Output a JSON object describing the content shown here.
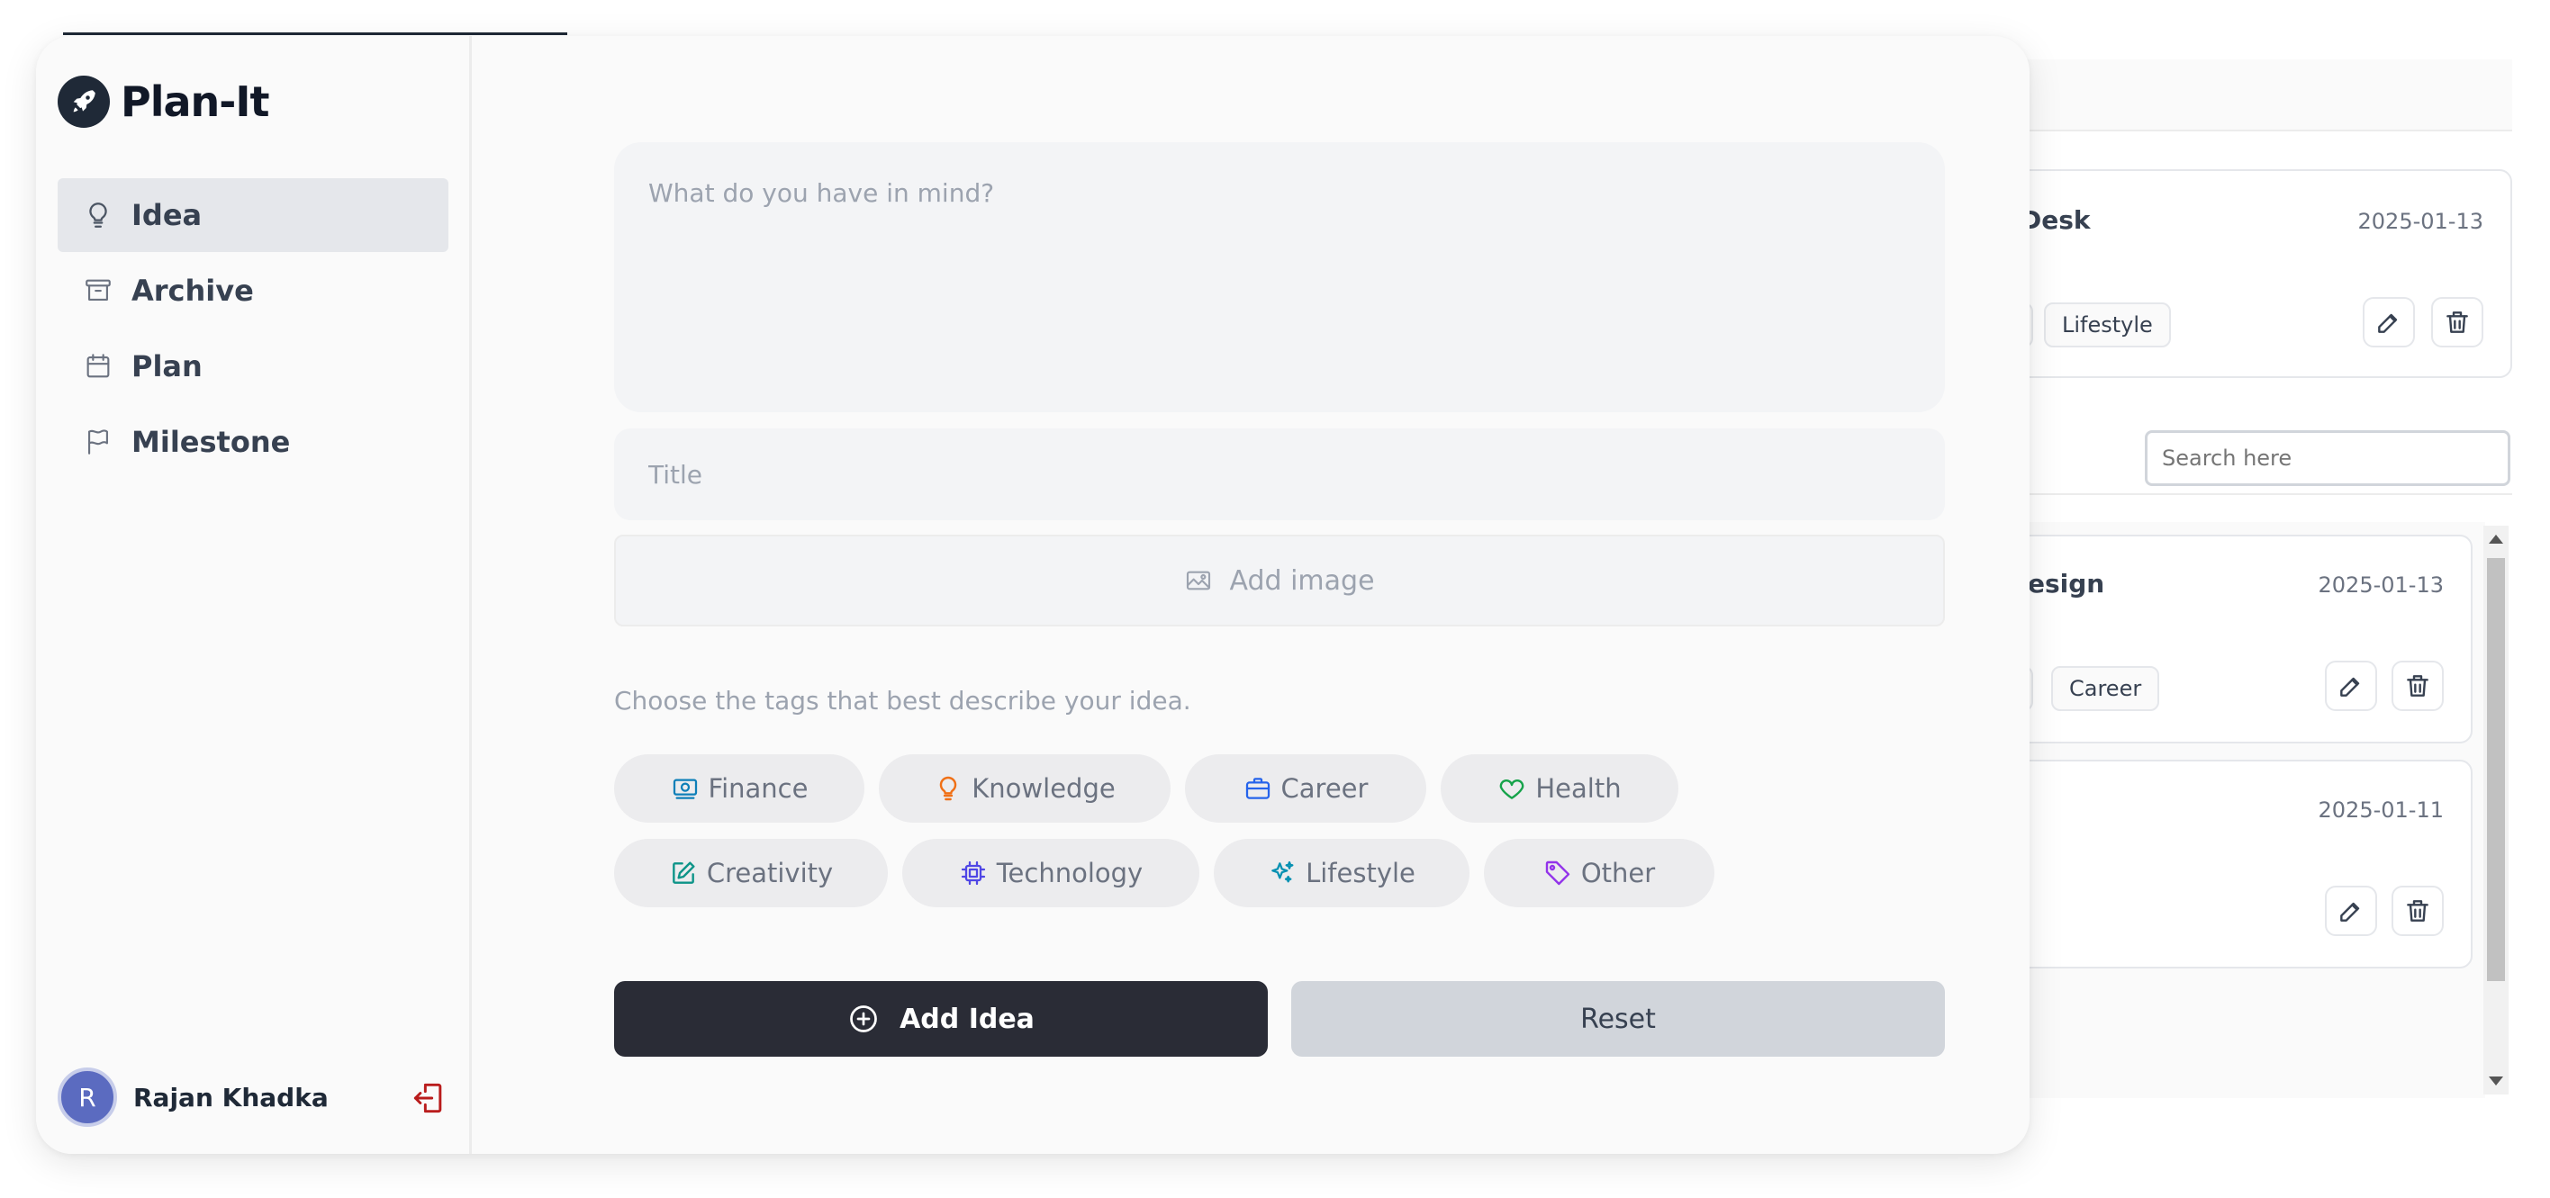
{
  "app": {
    "name": "Plan-It"
  },
  "sidebar": {
    "items": [
      {
        "label": "Idea",
        "icon": "lightbulb-icon",
        "active": true
      },
      {
        "label": "Archive",
        "icon": "archive-icon",
        "active": false
      },
      {
        "label": "Plan",
        "icon": "calendar-icon",
        "active": false
      },
      {
        "label": "Milestone",
        "icon": "flag-icon",
        "active": false
      }
    ],
    "user": {
      "initial": "R",
      "name": "Rajan Khadka"
    }
  },
  "form": {
    "idea_placeholder": "What do you have in mind?",
    "title_placeholder": "Title",
    "add_image_label": "Add image",
    "tag_prompt": "Choose the tags that best describe your idea.",
    "tags": [
      {
        "label": "Finance",
        "icon": "banknote-icon",
        "color": "#0e7fb8"
      },
      {
        "label": "Knowledge",
        "icon": "lightbulb-icon",
        "color": "#f07016"
      },
      {
        "label": "Career",
        "icon": "briefcase-icon",
        "color": "#2563eb"
      },
      {
        "label": "Health",
        "icon": "heart-icon",
        "color": "#16a34a"
      },
      {
        "label": "Creativity",
        "icon": "pencil-square-icon",
        "color": "#0d9488"
      },
      {
        "label": "Technology",
        "icon": "chip-icon",
        "color": "#4f46e5"
      },
      {
        "label": "Lifestyle",
        "icon": "sparkles-icon",
        "color": "#0891b2"
      },
      {
        "label": "Other",
        "icon": "tag-icon",
        "color": "#9333ea"
      }
    ],
    "add_button": "Add Idea",
    "reset_button": "Reset"
  },
  "background": {
    "search_placeholder": "Search here",
    "cards": [
      {
        "title_fragment": "Desk",
        "date": "2025-01-13",
        "tag": "Lifestyle"
      },
      {
        "title_fragment": "esign",
        "date": "2025-01-13",
        "tag": "Career"
      },
      {
        "title_fragment": "",
        "date": "2025-01-11",
        "tag": ""
      }
    ]
  },
  "colors": {
    "primary_button": "#2a2c36",
    "reset_button": "#d1d5db",
    "logout": "#b91c1c",
    "avatar": "#5b6bc0"
  }
}
